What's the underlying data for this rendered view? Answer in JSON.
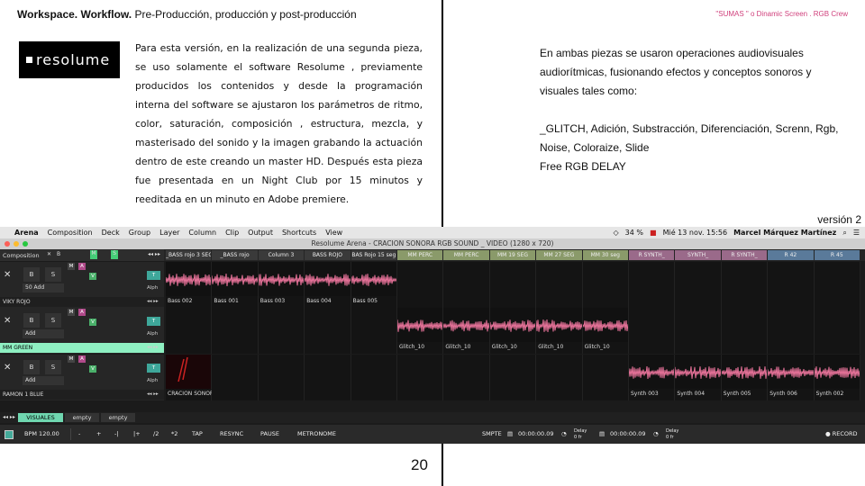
{
  "header": {
    "left_bold": "Workspace. Workflow.",
    "left_rest": "Pre-Producción, producción y post-producción",
    "right": "\"SUMAS \" o Dinamic Screen . RGB Crew"
  },
  "logo_text": "resolume",
  "left_paragraph": "Para esta versión, en la realización de una segunda pieza, se uso solamente  el software Resolume , previamente producidos los contenidos y desde la programación interna del software se ajustaron los parámetros de ritmo, color, saturación, composición , estructura, mezcla, y masterisado del sonido y la imagen grabando la actuación dentro de este creando un master HD. Después esta pieza fue presentada en un Night Club por 15 minutos y reeditada en un minuto en Adobe premiere.",
  "right_paragraph": {
    "intro": "En ambas piezas se usaron operaciones  audiovisuales audiorítmicas, fusionando efectos y  conceptos sonoros y visuales tales como:",
    "effects": "_GLITCH, Adición, Substracción, Diferenciación, Screnn, Rgb, Noise, Coloraize,  Slide",
    "extra": "Free RGB DELAY"
  },
  "version_label": "versión 2",
  "page_number": "20",
  "app": {
    "menu": [
      "Arena",
      "Composition",
      "Deck",
      "Group",
      "Layer",
      "Column",
      "Clip",
      "Output",
      "Shortcuts",
      "View"
    ],
    "status": {
      "battery": "34 %",
      "datetime": "Mié 13 nov.  15:56",
      "user": "Marcel Márquez Martínez"
    },
    "window_title": "Resolume Arena - CRACION SONORA RGB SOUND _ VIDEO (1280 x 720)",
    "composition_label": "Composition",
    "columns": [
      "_BASS rojo 3 SEG",
      "_BASS rojo",
      "Column 3",
      "BASS ROJO",
      "BAS Rojo 15 seg",
      "MM PERC",
      "MM PERC",
      "MM 19 SEG",
      "MM 27 SEG",
      "MM 30 seg",
      "R SYNTH_",
      "SYNTH_",
      "R SYNTH_",
      "R 42",
      "R 45"
    ],
    "column_colors": [
      "#3a3a3a",
      "#3a3a3a",
      "#3a3a3a",
      "#3a3a3a",
      "#3a3a3a",
      "#8a9a6a",
      "#8a9a6a",
      "#8a9a6a",
      "#8a9a6a",
      "#8a9a6a",
      "#9a6a8a",
      "#9a6a8a",
      "#9a6a8a",
      "#5a7a9a",
      "#5a7a9a"
    ],
    "layers": [
      {
        "name": "VIKY ROJO",
        "add": "50 Add",
        "clips": [
          "Bass 002",
          "Bass 001",
          "Bass 003",
          "Bass 004",
          "Bass 005",
          "",
          "",
          "",
          "",
          "",
          "",
          "",
          "",
          "",
          ""
        ]
      },
      {
        "name": "MM GREEN",
        "add": "Add",
        "clips": [
          "",
          "",
          "",
          "",
          "",
          "Glitch_10",
          "Glitch_10",
          "Glitch_10",
          "Glitch_10",
          "Glitch_10",
          "",
          "",
          "",
          "",
          ""
        ]
      },
      {
        "name": "RAMON 1 BLUE",
        "add": "Add",
        "clips": [
          "CRACION SONOR...",
          "",
          "",
          "",
          "",
          "",
          "",
          "",
          "",
          "",
          "Synth 003",
          "Synth 004",
          "Synth 005",
          "Synth 006",
          "Synth 002"
        ]
      }
    ],
    "decks": [
      "VISUALES",
      "empty",
      "empty"
    ],
    "transport": {
      "bpm": "BPM  120.00",
      "buttons": [
        "-",
        "+",
        "-|",
        "|+",
        "/2",
        "*2",
        "TAP",
        "RESYNC",
        "PAUSE",
        "METRONOME"
      ],
      "smpte": "SMPTE",
      "time1": "00:00:00.09",
      "time2": "00:00:00.09",
      "delay": "Delay",
      "delay_val": "0 fr",
      "record": "● RECORD"
    }
  }
}
